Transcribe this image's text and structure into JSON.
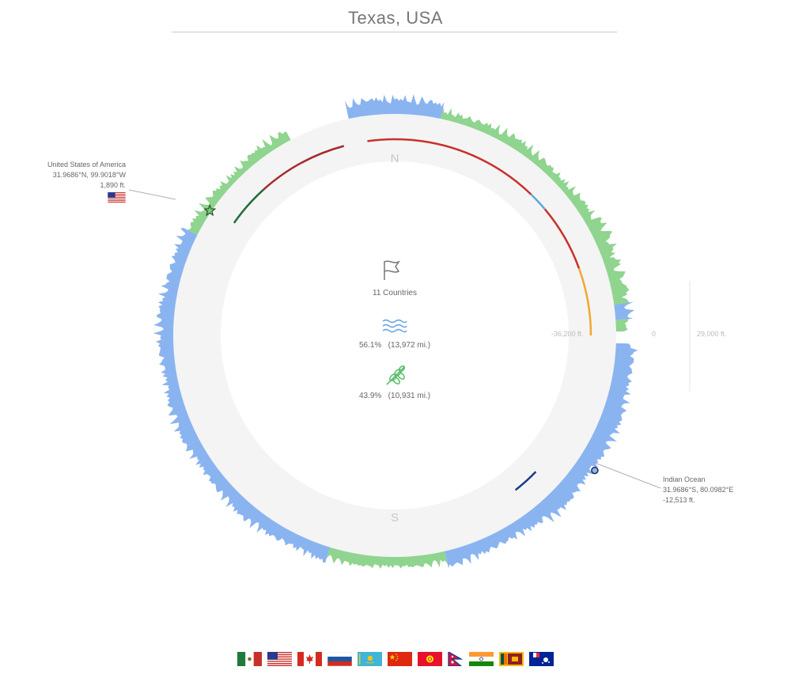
{
  "title": "Texas, USA",
  "compass": {
    "north": "N",
    "south": "S"
  },
  "summary": {
    "countries": "11 Countries",
    "water_pct": "56.1%",
    "water_dist": "(13,972 mi.)",
    "land_pct": "43.9%",
    "land_dist": "(10,931 mi.)"
  },
  "start_point": {
    "name": "United States of America",
    "coords": "31.9686°N, 99.9018°W",
    "elevation": "1,890 ft."
  },
  "antipode": {
    "name": "Indian Ocean",
    "coords": "31.9686°S, 80.0982°E",
    "elevation": "-12,513 ft."
  },
  "scale": {
    "min": "-36,200 ft.",
    "zero": "0",
    "max": "29,000 ft."
  },
  "colors": {
    "land": "#8fd48f",
    "water": "#8ab4f0",
    "track": "#f4f4f4"
  },
  "chart_data": {
    "type": "area",
    "description": "Radial elevation profile along a great circle; angle clockwise from north, 0 to 360 degrees",
    "segments": [
      {
        "from": 0,
        "to": 12,
        "kind": "water"
      },
      {
        "from": 12,
        "to": 82,
        "kind": "land"
      },
      {
        "from": 82,
        "to": 86,
        "kind": "water"
      },
      {
        "from": 86,
        "to": 89,
        "kind": "land"
      },
      {
        "from": 89,
        "to": 92,
        "kind": "none"
      },
      {
        "from": 92,
        "to": 167,
        "kind": "water"
      },
      {
        "from": 167,
        "to": 197,
        "kind": "land"
      },
      {
        "from": 197,
        "to": 242,
        "kind": "water"
      },
      {
        "from": 242,
        "to": 297,
        "kind": "water"
      },
      {
        "from": 297,
        "to": 332,
        "kind": "land"
      },
      {
        "from": 332,
        "to": 348,
        "kind": "none"
      },
      {
        "from": 348,
        "to": 360,
        "kind": "water"
      }
    ],
    "country_arcs": [
      {
        "from": 352,
        "to": 8,
        "color": "#c8312b"
      },
      {
        "from": 8,
        "to": 44,
        "color": "#c8312b"
      },
      {
        "from": 44,
        "to": 50,
        "color": "#5aa9d6"
      },
      {
        "from": 50,
        "to": 70,
        "color": "#c8312b"
      },
      {
        "from": 70,
        "to": 90,
        "color": "#f0a830"
      },
      {
        "from": 305,
        "to": 318,
        "color": "#1d6b3a"
      },
      {
        "from": 318,
        "to": 345,
        "color": "#a52a2a"
      },
      {
        "from": 134,
        "to": 142,
        "color": "#1a3a8c"
      }
    ],
    "start_marker_angle": 304,
    "antipode_marker_angle": 124,
    "countries": [
      "Mexico",
      "United States",
      "Canada",
      "Russia",
      "Kazakhstan",
      "China",
      "Kyrgyzstan",
      "Nepal",
      "India",
      "Sri Lanka",
      "French Southern Territories"
    ]
  },
  "flags": [
    "mexico-flag",
    "usa-flag",
    "canada-flag",
    "russia-flag",
    "kazakhstan-flag",
    "china-flag",
    "kyrgyzstan-flag",
    "nepal-flag",
    "india-flag",
    "sri-lanka-flag",
    "french-southern-flag"
  ]
}
